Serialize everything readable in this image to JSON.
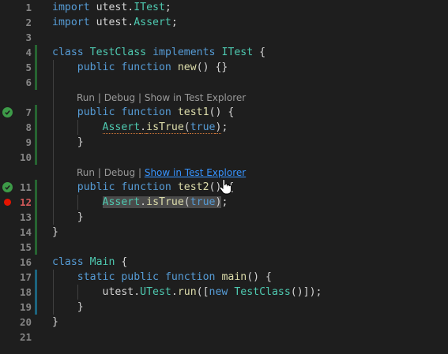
{
  "lines": [
    {
      "n": "1",
      "tokens": [
        {
          "t": "import",
          "c": "kw"
        },
        {
          "t": " utest.",
          "c": "pl"
        },
        {
          "t": "ITest",
          "c": "ty"
        },
        {
          "t": ";",
          "c": "pl"
        }
      ]
    },
    {
      "n": "2",
      "tokens": [
        {
          "t": "import",
          "c": "kw"
        },
        {
          "t": " utest.",
          "c": "pl"
        },
        {
          "t": "Assert",
          "c": "ty"
        },
        {
          "t": ";",
          "c": "pl"
        }
      ]
    },
    {
      "n": "3",
      "tokens": []
    },
    {
      "n": "4",
      "tokens": [
        {
          "t": "class",
          "c": "kw"
        },
        {
          "t": " ",
          "c": "pl"
        },
        {
          "t": "TestClass",
          "c": "ty"
        },
        {
          "t": " ",
          "c": "pl"
        },
        {
          "t": "implements",
          "c": "kw"
        },
        {
          "t": " ",
          "c": "pl"
        },
        {
          "t": "ITest",
          "c": "ty"
        },
        {
          "t": " {",
          "c": "pl"
        }
      ]
    },
    {
      "n": "5",
      "tokens": [
        {
          "t": "    ",
          "c": "pl"
        },
        {
          "t": "public",
          "c": "kw"
        },
        {
          "t": " ",
          "c": "pl"
        },
        {
          "t": "function",
          "c": "kw"
        },
        {
          "t": " ",
          "c": "pl"
        },
        {
          "t": "new",
          "c": "fn"
        },
        {
          "t": "() {}",
          "c": "pl"
        }
      ]
    },
    {
      "n": "6",
      "tokens": []
    },
    {
      "n": "7",
      "tokens": [
        {
          "t": "    ",
          "c": "pl"
        },
        {
          "t": "public",
          "c": "kw"
        },
        {
          "t": " ",
          "c": "pl"
        },
        {
          "t": "function",
          "c": "kw"
        },
        {
          "t": " ",
          "c": "pl"
        },
        {
          "t": "test1",
          "c": "fn"
        },
        {
          "t": "() {",
          "c": "pl"
        }
      ]
    },
    {
      "n": "8",
      "tokens": [
        {
          "t": "        ",
          "c": "pl"
        },
        {
          "t": "Assert",
          "c": "ty cov"
        },
        {
          "t": ".",
          "c": "pl cov"
        },
        {
          "t": "isTrue",
          "c": "fn cov"
        },
        {
          "t": "(",
          "c": "pl cov"
        },
        {
          "t": "true",
          "c": "kw cov"
        },
        {
          "t": ")",
          "c": "pl cov"
        },
        {
          "t": ";",
          "c": "pl"
        }
      ]
    },
    {
      "n": "9",
      "tokens": [
        {
          "t": "    }",
          "c": "pl"
        }
      ]
    },
    {
      "n": "10",
      "tokens": []
    },
    {
      "n": "11",
      "tokens": [
        {
          "t": "    ",
          "c": "pl"
        },
        {
          "t": "public",
          "c": "kw"
        },
        {
          "t": " ",
          "c": "pl"
        },
        {
          "t": "function",
          "c": "kw"
        },
        {
          "t": " ",
          "c": "pl"
        },
        {
          "t": "test2",
          "c": "fn"
        },
        {
          "t": "() {",
          "c": "pl"
        }
      ]
    },
    {
      "n": "12",
      "tokens": [
        {
          "t": "        ",
          "c": "pl"
        },
        {
          "t": "Assert",
          "c": "ty hl"
        },
        {
          "t": ".",
          "c": "pl hl"
        },
        {
          "t": "isTrue",
          "c": "fn hl"
        },
        {
          "t": "(",
          "c": "pl hl"
        },
        {
          "t": "true",
          "c": "kw hl"
        },
        {
          "t": ")",
          "c": "pl hl"
        },
        {
          "t": ";",
          "c": "pl"
        }
      ]
    },
    {
      "n": "13",
      "tokens": [
        {
          "t": "    }",
          "c": "pl"
        }
      ]
    },
    {
      "n": "14",
      "tokens": [
        {
          "t": "}",
          "c": "pl"
        }
      ]
    },
    {
      "n": "15",
      "tokens": []
    },
    {
      "n": "16",
      "tokens": [
        {
          "t": "class",
          "c": "kw"
        },
        {
          "t": " ",
          "c": "pl"
        },
        {
          "t": "Main",
          "c": "ty"
        },
        {
          "t": " {",
          "c": "pl"
        }
      ]
    },
    {
      "n": "17",
      "tokens": [
        {
          "t": "    ",
          "c": "pl"
        },
        {
          "t": "static",
          "c": "kw"
        },
        {
          "t": " ",
          "c": "pl"
        },
        {
          "t": "public",
          "c": "kw"
        },
        {
          "t": " ",
          "c": "pl"
        },
        {
          "t": "function",
          "c": "kw"
        },
        {
          "t": " ",
          "c": "pl"
        },
        {
          "t": "main",
          "c": "fn"
        },
        {
          "t": "() {",
          "c": "pl"
        }
      ]
    },
    {
      "n": "18",
      "tokens": [
        {
          "t": "        utest.",
          "c": "pl"
        },
        {
          "t": "UTest",
          "c": "ty"
        },
        {
          "t": ".",
          "c": "pl"
        },
        {
          "t": "run",
          "c": "fn"
        },
        {
          "t": "([",
          "c": "pl"
        },
        {
          "t": "new",
          "c": "kw"
        },
        {
          "t": " ",
          "c": "pl"
        },
        {
          "t": "TestClass",
          "c": "ty"
        },
        {
          "t": "()]);",
          "c": "pl"
        }
      ]
    },
    {
      "n": "19",
      "tokens": [
        {
          "t": "    }",
          "c": "pl"
        }
      ]
    },
    {
      "n": "20",
      "tokens": [
        {
          "t": "}",
          "c": "pl"
        }
      ]
    },
    {
      "n": "21",
      "tokens": []
    }
  ],
  "codelens": {
    "run": "Run",
    "sep": " | ",
    "debug": "Debug",
    "show": "Show in Test Explorer"
  },
  "colors": {
    "background": "#1e1e1e",
    "keyword": "#569cd6",
    "type": "#4ec9b0",
    "function": "#dcdcaa",
    "test_pass": "#3d9b48",
    "breakpoint": "#e51400",
    "link_hover": "#3794ff"
  }
}
